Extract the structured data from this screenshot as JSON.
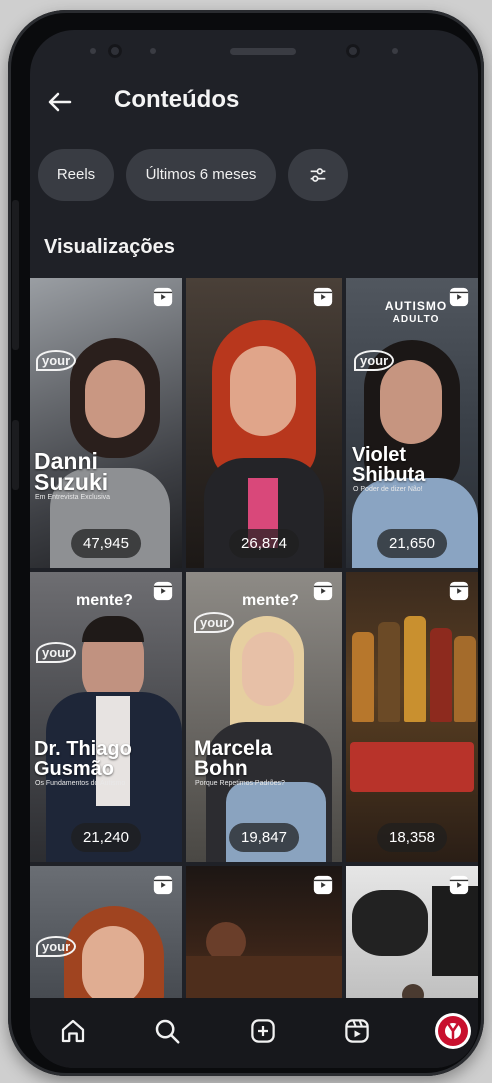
{
  "header": {
    "title": "Conteúdos"
  },
  "filters": {
    "type_label": "Reels",
    "period_label": "Últimos 6 meses"
  },
  "section": {
    "title": "Visualizações"
  },
  "tiles": [
    {
      "views": "47,945",
      "name_line1": "Danni",
      "name_line2": "Suzuki",
      "subtitle": "Em Entrevista Exclusiva",
      "brand": "your"
    },
    {
      "views": "26,874"
    },
    {
      "views": "21,650",
      "name_line1": "Violet",
      "name_line2": "Shibuta",
      "subtitle": "O Poder de dizer Não!",
      "brand": "your",
      "badge_line1": "AUTISMO",
      "badge_line2": "ADULTO"
    },
    {
      "views": "21,240",
      "name_line1": "Dr. Thiago",
      "name_line2": "Gusmão",
      "subtitle": "Os Fundamentos do Autismo",
      "brand": "your",
      "badge": "mente?"
    },
    {
      "views": "19,847",
      "name_line1": "Marcela",
      "name_line2": "Bohn",
      "subtitle": "Porque Repetimos Padrões?",
      "brand": "your",
      "badge": "mente?"
    },
    {
      "views": "18,358"
    },
    {
      "brand": "your"
    },
    {},
    {}
  ],
  "nav": {
    "items": [
      "home-icon",
      "search-icon",
      "create-icon",
      "reels-icon",
      "profile-avatar"
    ]
  },
  "colors": {
    "background": "#1f2127",
    "chip": "#393c43",
    "text": "#f4f4f4"
  }
}
